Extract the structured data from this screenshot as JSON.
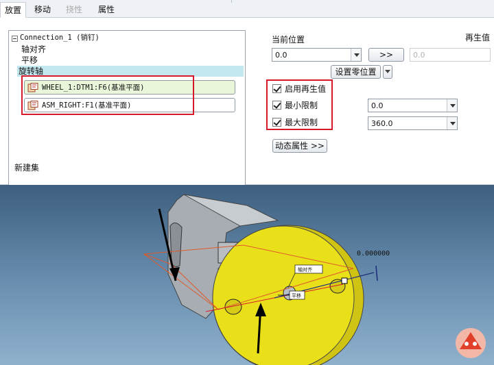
{
  "tabs": [
    "放置",
    "移动",
    "挠性",
    "属性"
  ],
  "tree": {
    "connection": "Connection_1 (销钉)",
    "items": [
      "轴对齐",
      "平移",
      "旋转轴"
    ],
    "refs": [
      "WHEEL_1:DTM1:F6(基准平面)",
      "ASM_RIGHT:F1(基准平面)"
    ],
    "new_set": "新建集"
  },
  "right": {
    "current_position_label": "当前位置",
    "regen_value_label": "再生值",
    "current_position_value": "0.0",
    "arrow_button": ">>",
    "regen_value": "0.0",
    "set_zero_button": "设置零位置",
    "enable_regen_label": "启用再生值",
    "min_limit_label": "最小限制",
    "min_limit_value": "0.0",
    "max_limit_label": "最大限制",
    "max_limit_value": "360.0",
    "dynamic_props_button": "动态属性 >>"
  },
  "viewport": {
    "dimension_value": "0.000000",
    "tag_axis": "轴对齐",
    "tag_translate": "平移"
  },
  "colors": {
    "highlight_red": "#d6182b",
    "wheel_yellow": "#e9e01a",
    "selection_blue": "#c3e7ee"
  }
}
